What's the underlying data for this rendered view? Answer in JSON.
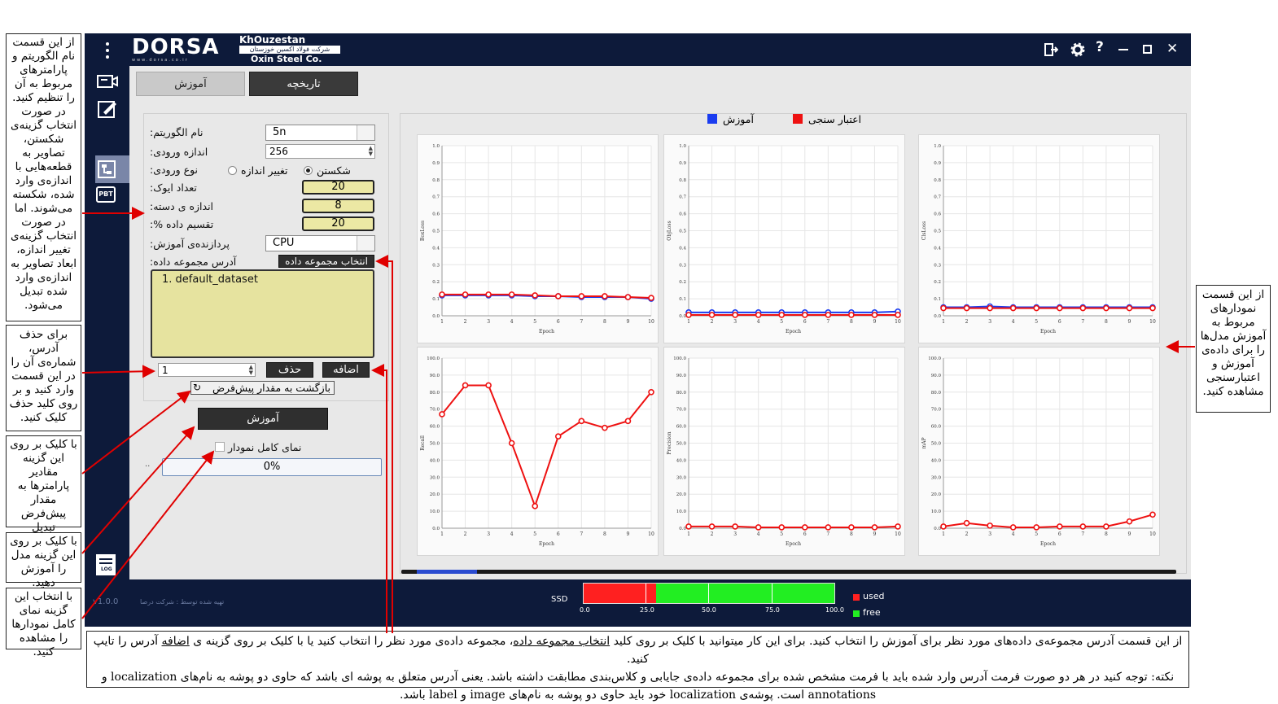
{
  "app": {
    "brand_text": "DORSA",
    "brand_sub": "www.dorsa.co.ir",
    "company_line1": "KhOuzestan",
    "company_line2": "شرکت فولاد اکسین خوزستان",
    "company_line3": "Oxin Steel Co.",
    "version": "v1.0.0",
    "credit": "تهیه شده توسط : شرکت درصا"
  },
  "sidebar": {
    "icons": [
      "camera-icon",
      "edit-icon",
      "workflow-icon",
      "pbt-icon",
      "log-icon"
    ],
    "pbt_label": "PBT",
    "log_label": "LOG"
  },
  "tabs": {
    "train": "آموزش",
    "history": "تاریخچه"
  },
  "form": {
    "algorithm_label": "نام الگوریتم:",
    "algorithm_value": "5n",
    "input_size_label": "اندازه ورودی:",
    "input_size_value": "256",
    "input_type_label": "نوع ورودی:",
    "radio_resize": "تغییر اندازه",
    "radio_split": "شکستن",
    "epochs_label": "تعداد ایوک:",
    "epochs_value": "20",
    "batch_label": "اندازه ی دسته:",
    "batch_value": "8",
    "split_label": "تقسیم داده %:",
    "split_value": "20",
    "processor_label": "پردازنده‌ی آموزش:",
    "processor_value": "CPU",
    "dataset_label": "آدرس مجموعه داده:",
    "select_dataset_btn": "انتخاب مجموعه داده",
    "dataset_item": "1. default_dataset",
    "index_value": "1",
    "delete_btn": "حذف",
    "add_btn": "اضافه",
    "reset_btn": "بازگشت به مقدار پیش‌فرض",
    "train_btn": "آموزش",
    "fullview_label": "نمای کامل نمودار",
    "progress_text": "0%"
  },
  "legend": {
    "train": "آموزش",
    "val": "اعتبار سنجی",
    "train_color": "#1a3cf0",
    "val_color": "#ee1111"
  },
  "storage": {
    "label": "SSD",
    "used_label": "used",
    "free_label": "free",
    "used_color": "#ff2020",
    "free_color": "#22ee22",
    "ticks": [
      "0.0",
      "25.0",
      "50.0",
      "75.0",
      "100.0"
    ],
    "used_fraction": 0.29
  },
  "notes": {
    "n1": "از این قسمت نام الگوریتم و پارامترهای مربوط به آن را تنظیم کنید. در صورت انتخاب گزینه‌ی شکستن، تصاویر به قطعه‌هایی با اندازه‌ی وارد شده، شکسته می‌شوند. اما در صورت انتخاب گزینه‌ی تغییر اندازه، ابعاد تصاویر به اندازه‌ی وارد شده تبدیل می‌شود.",
    "n2": "برای حذف آدرس، شماره‌ی آن را در این قسمت وارد کنید و بر روی کلید حذف کلیک کنید.",
    "n3": "با کلیک بر روی این گزینه مقادیر پارامترها به مقدار پیش‌فرض تبدیل می‌شوند.",
    "n4": "با کلیک بر روی این گزینه مدل را آموزش دهید.",
    "n5": "با انتخاب این گزینه نمای کامل نمودارها را مشاهده کنید.",
    "n6": "از این قسمت نمودارهای مربوط به آموزش مدل‌ها را برای داده‌ی آموزش و اعتبارسنجی مشاهده کنید.",
    "bottom_a": "از این قسمت آدرس مجموعه‌ی داده‌های مورد نظر برای آموزش را انتخاب کنید. برای این کار میتوانید با کلیک بر روی کلید ",
    "bottom_u1": "انتخاب مجموعه داده",
    "bottom_b": "، مجموعه داده‌ی مورد نظر را انتخاب کنید یا با کلیک بر روی گزینه ی ",
    "bottom_u2": "اضافه",
    "bottom_c": " آدرس را تایپ کنید.",
    "bottom_d": "نکته: توجه کنید در هر دو صورت فرمت آدرس وارد شده باید با فرمت مشخص شده برای مجموعه داده‌ی جایابی و کلاس‌بندی مطابقت داشته باشد. یعنی آدرس متعلق به پوشه ای باشد که حاوی دو پوشه به نام‌های localization و annotations است. پوشه‌ی localization خود باید حاوی دو پوشه به نام‌های image و label باشد."
  },
  "chart_data": [
    {
      "type": "line",
      "ylabel": "BoxLoss",
      "xlabel": "Epoch",
      "x": [
        1,
        2,
        3,
        4,
        5,
        6,
        7,
        8,
        9,
        10
      ],
      "ylim": [
        0,
        1.0
      ],
      "yticks": [
        "0.0",
        "0.1",
        "0.2",
        "0.3",
        "0.4",
        "0.5",
        "0.6",
        "0.7",
        "0.8",
        "0.9",
        "1.0"
      ],
      "series": [
        {
          "name": "آموزش",
          "values": [
            0.12,
            0.12,
            0.12,
            0.12,
            0.115,
            0.115,
            0.11,
            0.11,
            0.11,
            0.1
          ]
        },
        {
          "name": "اعتبار سنجی",
          "values": [
            0.125,
            0.125,
            0.125,
            0.125,
            0.12,
            0.115,
            0.115,
            0.115,
            0.11,
            0.105
          ]
        }
      ]
    },
    {
      "type": "line",
      "ylabel": "ObjLoss",
      "xlabel": "Epoch",
      "x": [
        1,
        2,
        3,
        4,
        5,
        6,
        7,
        8,
        9,
        10
      ],
      "ylim": [
        0,
        1.0
      ],
      "yticks": [
        "0.0",
        "0.1",
        "0.2",
        "0.3",
        "0.4",
        "0.5",
        "0.6",
        "0.7",
        "0.8",
        "0.9",
        "1.0"
      ],
      "series": [
        {
          "name": "آموزش",
          "values": [
            0.02,
            0.02,
            0.02,
            0.02,
            0.02,
            0.02,
            0.02,
            0.02,
            0.02,
            0.025
          ]
        },
        {
          "name": "اعتبار سنجی",
          "values": [
            0.005,
            0.005,
            0.005,
            0.005,
            0.005,
            0.005,
            0.005,
            0.005,
            0.005,
            0.005
          ]
        }
      ]
    },
    {
      "type": "line",
      "ylabel": "ClsLoss",
      "xlabel": "Epoch",
      "x": [
        1,
        2,
        3,
        4,
        5,
        6,
        7,
        8,
        9,
        10
      ],
      "ylim": [
        0,
        1.0
      ],
      "yticks": [
        "0.0",
        "0.1",
        "0.2",
        "0.3",
        "0.4",
        "0.5",
        "0.6",
        "0.7",
        "0.8",
        "0.9",
        "1.0"
      ],
      "series": [
        {
          "name": "آموزش",
          "values": [
            0.05,
            0.05,
            0.055,
            0.05,
            0.05,
            0.05,
            0.05,
            0.05,
            0.05,
            0.05
          ]
        },
        {
          "name": "اعتبار سنجی",
          "values": [
            0.045,
            0.045,
            0.045,
            0.045,
            0.045,
            0.045,
            0.045,
            0.045,
            0.045,
            0.045
          ]
        }
      ]
    },
    {
      "type": "line",
      "ylabel": "Recall",
      "xlabel": "Epoch",
      "x": [
        1,
        2,
        3,
        4,
        5,
        6,
        7,
        8,
        9,
        10
      ],
      "ylim": [
        0,
        100
      ],
      "yticks": [
        "0.0",
        "10.0",
        "20.0",
        "30.0",
        "40.0",
        "50.0",
        "60.0",
        "70.0",
        "80.0",
        "90.0",
        "100.0"
      ],
      "series": [
        {
          "name": "اعتبار سنجی",
          "values": [
            67,
            84,
            84,
            50,
            13,
            54,
            63,
            59,
            63,
            80
          ]
        }
      ]
    },
    {
      "type": "line",
      "ylabel": "Precision",
      "xlabel": "Epoch",
      "x": [
        1,
        2,
        3,
        4,
        5,
        6,
        7,
        8,
        9,
        10
      ],
      "ylim": [
        0,
        100
      ],
      "yticks": [
        "0.0",
        "10.0",
        "20.0",
        "30.0",
        "40.0",
        "50.0",
        "60.0",
        "70.0",
        "80.0",
        "90.0",
        "100.0"
      ],
      "series": [
        {
          "name": "اعتبار سنجی",
          "values": [
            1,
            1,
            1,
            0.5,
            0.5,
            0.5,
            0.5,
            0.5,
            0.5,
            1
          ]
        }
      ]
    },
    {
      "type": "line",
      "ylabel": "mAP",
      "xlabel": "Epoch",
      "x": [
        1,
        2,
        3,
        4,
        5,
        6,
        7,
        8,
        9,
        10
      ],
      "ylim": [
        0,
        100
      ],
      "yticks": [
        "0.0",
        "10.0",
        "20.0",
        "30.0",
        "40.0",
        "50.0",
        "60.0",
        "70.0",
        "80.0",
        "90.0",
        "100.0"
      ],
      "series": [
        {
          "name": "اعتبار سنجی",
          "values": [
            1,
            3,
            1.5,
            0.5,
            0.5,
            1,
            1,
            1,
            4,
            8
          ]
        }
      ]
    }
  ]
}
